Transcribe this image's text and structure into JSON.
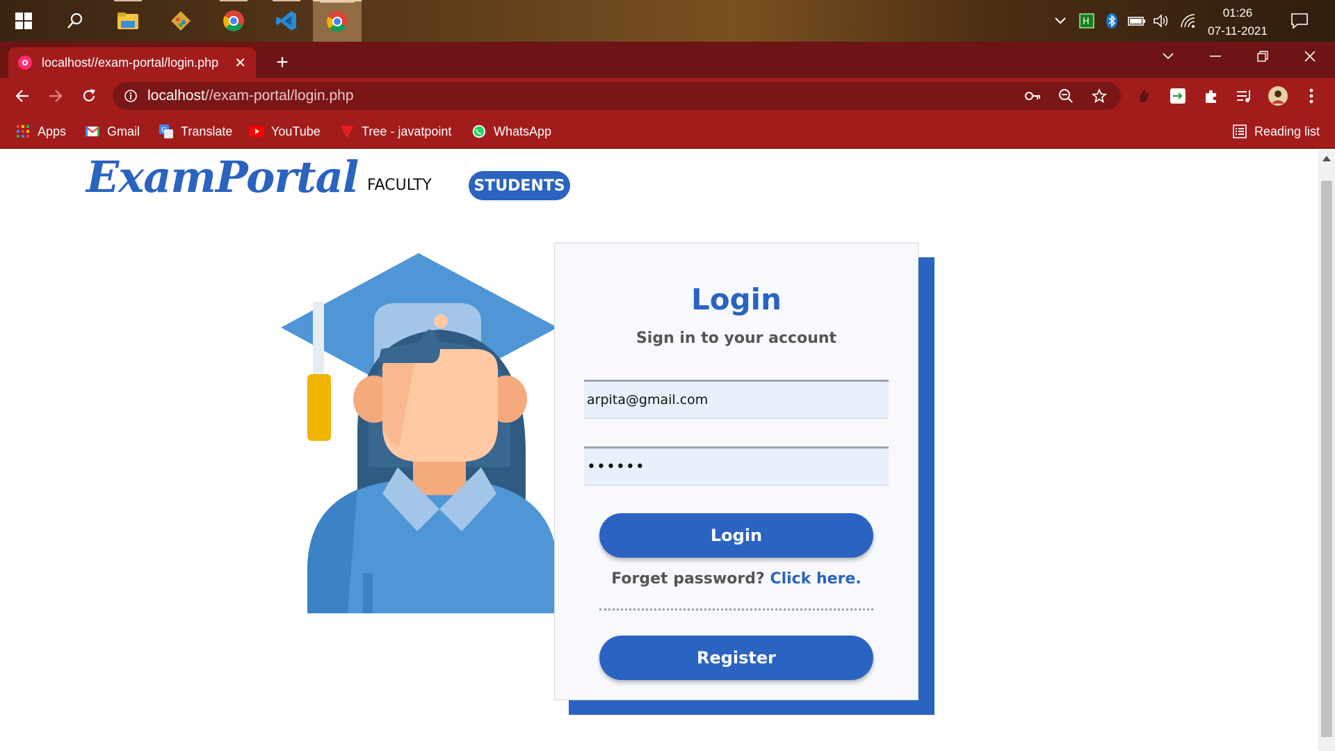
{
  "taskbar": {
    "clock_time": "01:26",
    "clock_date": "07-11-2021"
  },
  "browser": {
    "tab_title": "localhost//exam-portal/login.php",
    "new_tab_label": "+",
    "url_host": "localhost",
    "url_path": "//exam-portal/login.php",
    "bookmarks": [
      {
        "label": "Apps",
        "icon": "apps-grid-icon"
      },
      {
        "label": "Gmail",
        "icon": "gmail-icon"
      },
      {
        "label": "Translate",
        "icon": "translate-icon"
      },
      {
        "label": "YouTube",
        "icon": "youtube-icon"
      },
      {
        "label": "Tree - javatpoint",
        "icon": "javatpoint-icon"
      },
      {
        "label": "WhatsApp",
        "icon": "whatsapp-icon"
      }
    ],
    "reading_list": "Reading list",
    "theme_color": "#a31c1c"
  },
  "page": {
    "logo": "ExamPortal",
    "nav": {
      "faculty": "FACULTY",
      "students": "STUDENTS"
    },
    "login": {
      "title": "Login",
      "subtitle": "Sign in to your account",
      "email_value": "arpita@gmail.com",
      "password_value": "••••••",
      "login_button": "Login",
      "forget_text": "Forget password?",
      "forget_link": "Click here.",
      "register_button": "Register"
    },
    "accent_color": "#2a63c0"
  }
}
